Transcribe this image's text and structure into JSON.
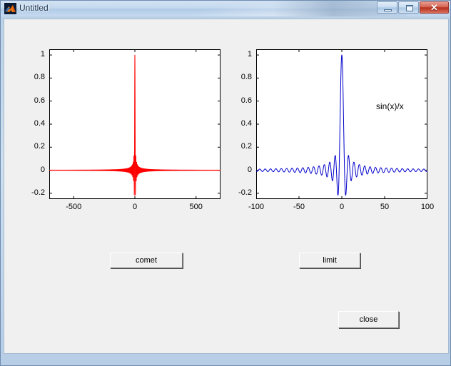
{
  "window": {
    "title": "Untitled",
    "icon": "matlab-membrane-icon",
    "controls": {
      "minimize_label": "",
      "maximize_label": "",
      "close_label": "✕"
    },
    "background_color": "#f0f0f0",
    "titlebar_color": "#c3d8ee"
  },
  "buttons": [
    {
      "name": "comet-button",
      "label": "comet"
    },
    {
      "name": "limit-button",
      "label": "limit"
    },
    {
      "name": "close-button",
      "label": "close"
    }
  ],
  "chart_data": [
    {
      "id": "left-axes",
      "type": "line",
      "title": "",
      "xlabel": "",
      "ylabel": "",
      "color": "#ff0000",
      "line_color_hex": "#ff0000",
      "xlim": [
        -700,
        700
      ],
      "ylim": [
        -0.25,
        1.05
      ],
      "xticks": [
        -500,
        0,
        500
      ],
      "xticklabels": [
        "-500",
        "0",
        "500"
      ],
      "yticks": [
        -0.2,
        0,
        0.2,
        0.4,
        0.6,
        0.8,
        1
      ],
      "yticklabels": [
        "-0.2",
        "0",
        "0.2",
        "0.4",
        "0.6",
        "0.8",
        "1"
      ],
      "grid": false,
      "legend": "none",
      "function": "sin(x)/x",
      "series": [
        {
          "name": "sin(x)/x",
          "peak_value": 1,
          "peak_x": 0,
          "min_value": -0.217
        }
      ]
    },
    {
      "id": "right-axes",
      "type": "line",
      "title": "",
      "xlabel": "",
      "ylabel": "",
      "color": "#0000cc",
      "line_color_hex": "#0000cc",
      "xlim": [
        -100,
        100
      ],
      "ylim": [
        -0.25,
        1.05
      ],
      "xticks": [
        -100,
        -50,
        0,
        50,
        100
      ],
      "xticklabels": [
        "-100",
        "-50",
        "0",
        "50",
        "100"
      ],
      "yticks": [
        -0.2,
        0,
        0.2,
        0.4,
        0.6,
        0.8,
        1
      ],
      "yticklabels": [
        "-0.2",
        "0",
        "0.2",
        "0.4",
        "0.6",
        "0.8",
        "1"
      ],
      "grid": false,
      "legend": "none",
      "function": "sin(x)/x",
      "annotation": {
        "text": "sin(x)/x",
        "x": 40,
        "y": 0.55
      },
      "series": [
        {
          "name": "sin(x)/x",
          "peak_value": 1,
          "peak_x": 0,
          "min_value": -0.217
        }
      ]
    }
  ]
}
